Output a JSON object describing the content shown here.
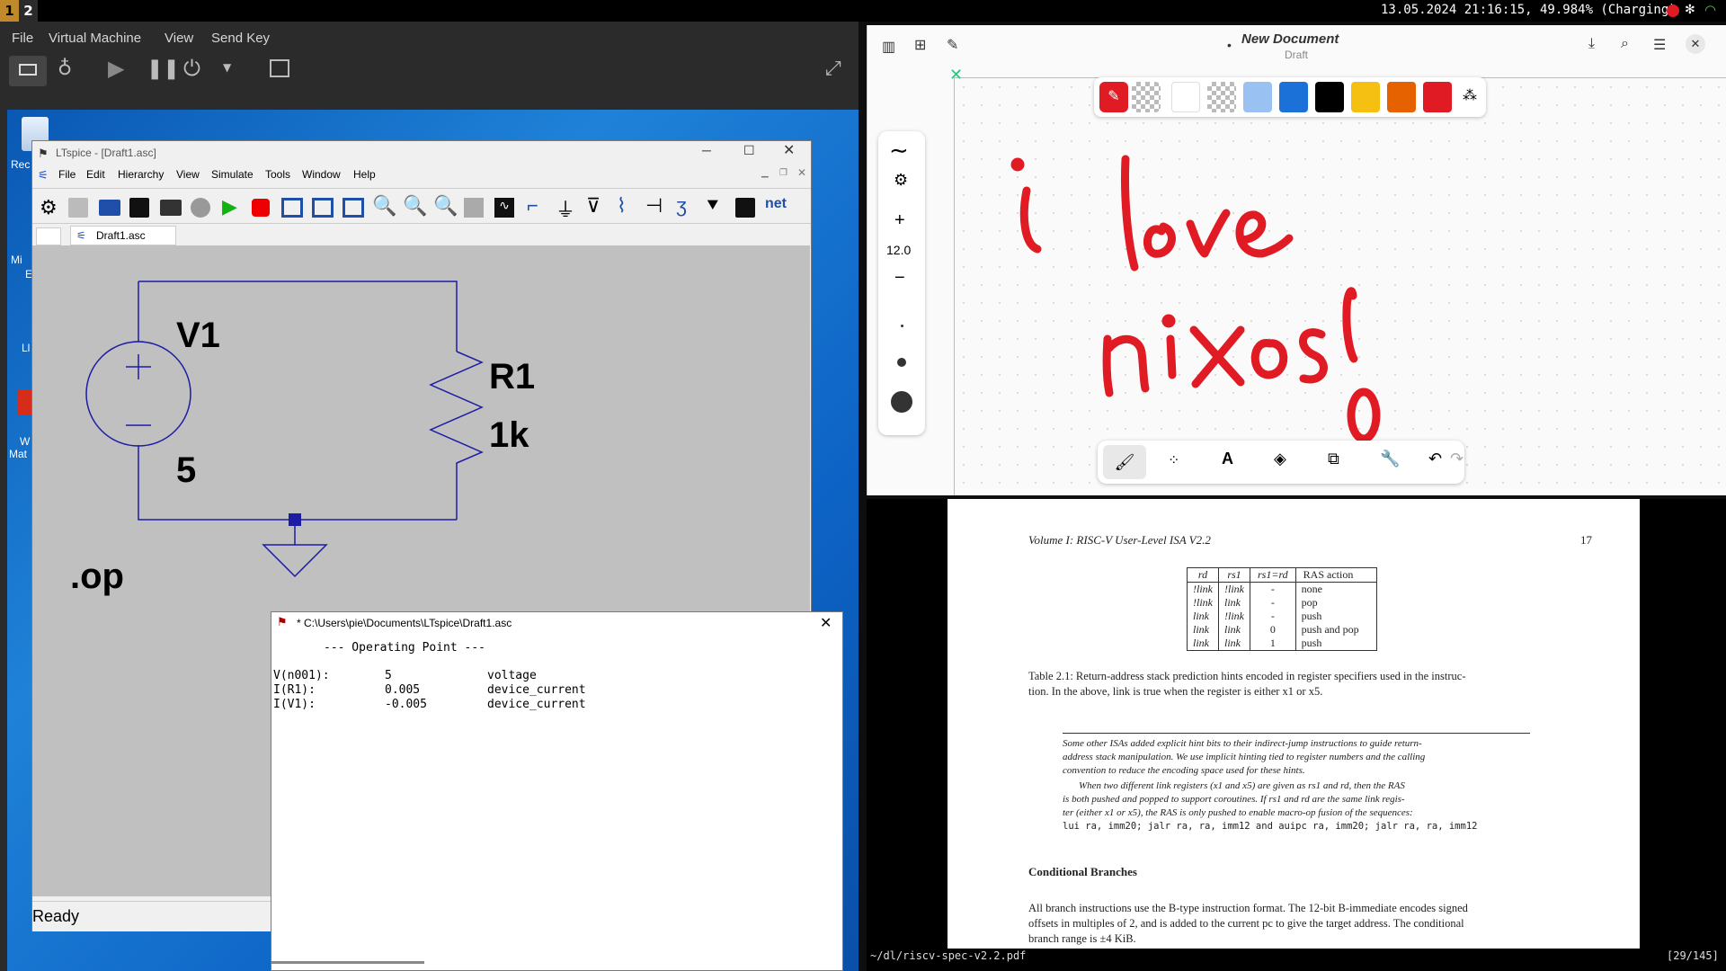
{
  "topbar": {
    "workspace1": "1",
    "workspace2": "2",
    "status": "13.05.2024 21:16:15, 49.984% (Charging)"
  },
  "vm": {
    "menu": [
      "File",
      "Virtual Machine",
      "View",
      "Send Key"
    ]
  },
  "desktop": {
    "icon_labels": [
      "Rec",
      "Mi",
      "E",
      "Ll",
      "W",
      "Mat"
    ]
  },
  "ltspice": {
    "title": "LTspice - [Draft1.asc]",
    "menu": [
      "File",
      "Edit",
      "Hierarchy",
      "View",
      "Simulate",
      "Tools",
      "Window",
      "Help"
    ],
    "tab": "Draft1.asc",
    "net_label": "net",
    "status": "Ready",
    "schematic": {
      "v_name": "V1",
      "v_value": "5",
      "r_name": "R1",
      "r_value": "1k",
      "directive": ".op"
    }
  },
  "oppoint": {
    "title": "* C:\\Users\\pie\\Documents\\LTspice\\Draft1.asc",
    "header": "--- Operating Point ---",
    "rows": [
      {
        "name": "V(n001):",
        "value": "5",
        "type": "voltage"
      },
      {
        "name": "I(R1):",
        "value": "0.005",
        "type": "device_current"
      },
      {
        "name": "I(V1):",
        "value": "-0.005",
        "type": "device_current"
      }
    ]
  },
  "notes": {
    "title": "New Document",
    "subtitle": "Draft",
    "zoom": "12.0",
    "zoom_plus": "+",
    "zoom_minus": "−",
    "handwriting": "i love nixos!",
    "colors": [
      "#ffffff",
      "#99c1f1",
      "#1c71d8",
      "#000000",
      "#f6c012",
      "#e66100",
      "#e01b24"
    ],
    "active_color": "#e01b24"
  },
  "pdf": {
    "header_left": "Volume I: RISC-V User-Level ISA V2.2",
    "page_no": "17",
    "table_headers": [
      "rd",
      "rs1",
      "rs1=rd",
      "RAS action"
    ],
    "table_rows": [
      [
        "!link",
        "!link",
        "-",
        "none"
      ],
      [
        "!link",
        "link",
        "-",
        "pop"
      ],
      [
        "link",
        "!link",
        "-",
        "push"
      ],
      [
        "link",
        "link",
        "0",
        "push and pop"
      ],
      [
        "link",
        "link",
        "1",
        "push"
      ]
    ],
    "caption1": "Table 2.1: Return-address stack prediction hints encoded in register specifiers used in the instruc-",
    "caption2": "tion. In the above, link is true when the register is either x1 or x5.",
    "comment1": "Some other ISAs added explicit hint bits to their indirect-jump instructions to guide return-",
    "comment2": "address stack manipulation. We use implicit hinting tied to register numbers and the calling",
    "comment3": "convention to reduce the encoding space used for these hints.",
    "comment4": "When two different link registers (x1 and x5) are given as rs1 and rd, then the RAS",
    "comment5": "is both pushed and popped to support coroutines. If rs1 and rd are the same link regis-",
    "comment6": "ter (either x1 or x5), the RAS is only pushed to enable macro-op fusion of the sequences:",
    "comment7": "lui ra, imm20; jalr ra, ra, imm12 and auipc ra, imm20; jalr ra, ra, imm12",
    "section": "Conditional Branches",
    "body1": "All branch instructions use the B-type instruction format. The 12-bit B-immediate encodes signed",
    "body2": "offsets in multiples of 2, and is added to the current pc to give the target address. The conditional",
    "body3": "branch range is ±4 KiB.",
    "file": "~/dl/riscv-spec-v2.2.pdf",
    "pages": "[29/145]"
  }
}
